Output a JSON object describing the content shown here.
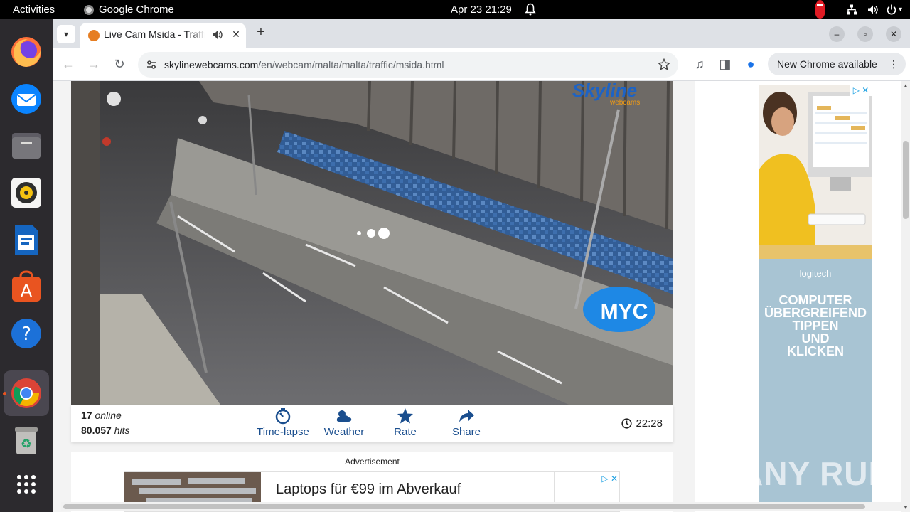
{
  "topbar": {
    "activities": "Activities",
    "app_name": "Google Chrome",
    "clock": "Apr 23  21:29"
  },
  "dock": {
    "items": [
      "firefox-icon",
      "thunderbird-icon",
      "files-icon",
      "rhythmbox-icon",
      "libreoffice-writer-icon",
      "app-center-icon",
      "help-icon",
      "chrome-icon",
      "trash-icon",
      "show-apps-icon"
    ]
  },
  "browser": {
    "tab_title": "Live Cam Msida - Traffic",
    "url_domain": "skylinewebcams.com",
    "url_path": "/en/webcam/malta/malta/traffic/msida.html",
    "update_label": "New Chrome available"
  },
  "webcam": {
    "online_count": "17",
    "online_label": "online",
    "hits_count": "80.057",
    "hits_label": "hits",
    "actions": [
      "Time-lapse",
      "Weather",
      "Rate",
      "Share"
    ],
    "time": "22:28",
    "overlay_brand": "Skyline",
    "overlay_brand_sub": "webcams",
    "overlay_logo": "MYC"
  },
  "ads": {
    "label": "Advertisement",
    "banner_text": "Laptops für €99 im Abverkauf",
    "side_brand": "logitech",
    "side_lines": [
      "COMPUTER",
      "ÜBERGREIFEND",
      "TIPPEN",
      "UND",
      "KLICKEN"
    ]
  },
  "watermark": "ANY RUN",
  "colors": {
    "accent_blue": "#1a4e8e",
    "ubuntu_orange": "#e95420",
    "ad_sky": "#a8c4d3"
  }
}
